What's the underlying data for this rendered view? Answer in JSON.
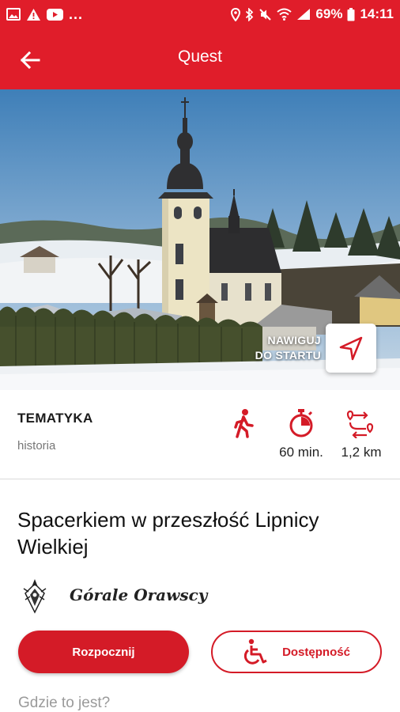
{
  "status_bar": {
    "overflow": "...",
    "battery": "69%",
    "time": "14:11",
    "icons": [
      "image-icon",
      "warning-icon",
      "youtube-icon",
      "location-icon",
      "bluetooth-icon",
      "mute-icon",
      "wifi-icon",
      "signal-icon",
      "battery-icon"
    ]
  },
  "app_bar": {
    "title": "Quest",
    "back_icon": "arrow-left-icon"
  },
  "hero": {
    "navigate_label": "NAWIGUJ\nDO STARTU",
    "navigate_icon": "navigation-arrow-icon"
  },
  "info": {
    "topic_label": "TEMATYKA",
    "topic_value": "historia",
    "mode_icon": "walking-icon",
    "duration": "60 min.",
    "duration_icon": "stopwatch-icon",
    "distance": "1,2 km",
    "distance_icon": "route-icon"
  },
  "quest": {
    "title": "Spacerkiem w przeszłość Lipnicy Wielkiej"
  },
  "author": {
    "name": "Górale Orawscy"
  },
  "actions": {
    "start_label": "Rozpocznij",
    "accessibility_label": "Dostępność",
    "accessibility_icon": "wheelchair-icon"
  },
  "location": {
    "heading": "Gdzie to jest?"
  },
  "colors": {
    "accent": "#e01d2a",
    "button_red": "#d41b27",
    "muted_text": "#777777"
  }
}
